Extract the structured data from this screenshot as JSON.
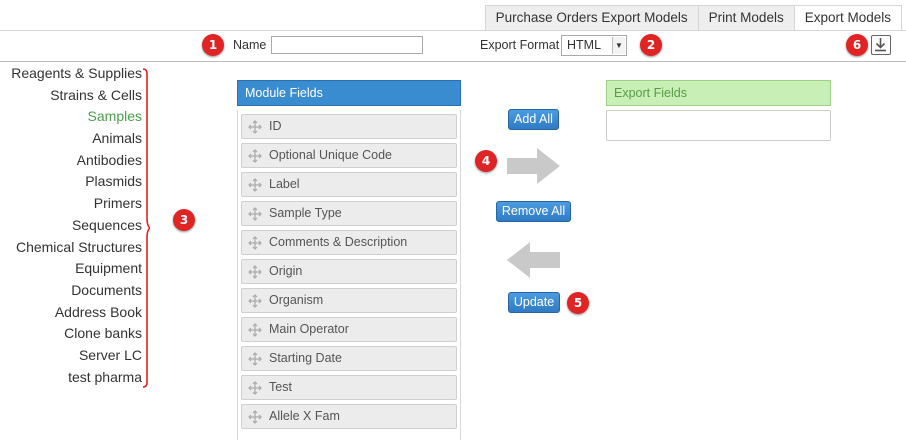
{
  "tabs": [
    {
      "label": "Purchase Orders Export Models",
      "active": false
    },
    {
      "label": "Print Models",
      "active": false
    },
    {
      "label": "Export Models",
      "active": true
    }
  ],
  "form": {
    "name_label": "Name",
    "name_value": "",
    "format_label": "Export Format",
    "format_value": "HTML"
  },
  "callouts": [
    "1",
    "2",
    "3",
    "4",
    "5",
    "6"
  ],
  "modules": [
    "Reagents & Supplies",
    "Strains & Cells",
    "Samples",
    "Animals",
    "Antibodies",
    "Plasmids",
    "Primers",
    "Sequences",
    "Chemical Structures",
    "Equipment",
    "Documents",
    "Address Book",
    "Clone banks",
    "Server LC",
    "test pharma"
  ],
  "active_module": "Samples",
  "module_fields_title": "Module Fields",
  "module_fields": [
    "ID",
    "Optional Unique Code",
    "Label",
    "Sample Type",
    "Comments & Description",
    "Origin",
    "Organism",
    "Main Operator",
    "Starting Date",
    "Test",
    "Allele X Fam"
  ],
  "export_fields_title": "Export Fields",
  "buttons": {
    "add_all": "Add All",
    "remove_all": "Remove All",
    "update": "Update"
  },
  "icons": {
    "export": "download-icon",
    "drag": "move-icon",
    "arrow_right": "arrow-right-icon",
    "arrow_left": "arrow-left-icon"
  },
  "colors": {
    "callout": "#e02424",
    "primary": "#3a8cd0",
    "export_header": "#c8f0b6",
    "active_module": "#4aa148",
    "bracket": "#e02424"
  }
}
